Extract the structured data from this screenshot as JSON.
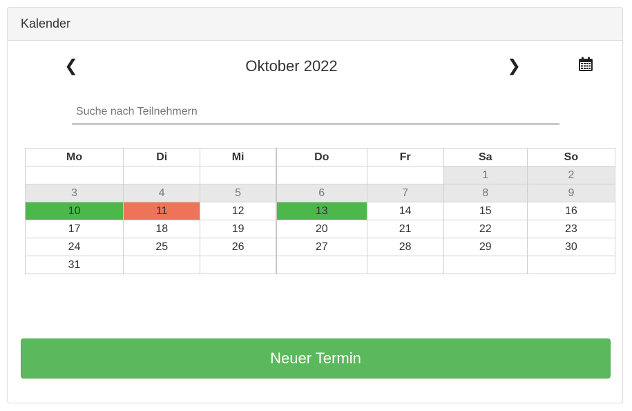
{
  "panel": {
    "title": "Kalender"
  },
  "nav": {
    "prev_icon": "❮",
    "next_icon": "❯",
    "month_title": "Oktober 2022",
    "calendar_icon": "calendar-icon"
  },
  "search": {
    "placeholder": "Suche nach Teilnehmern",
    "value": ""
  },
  "calendar": {
    "weekdays": [
      "Mo",
      "Di",
      "Mi",
      "Do",
      "Fr",
      "Sa",
      "So"
    ],
    "weeks": [
      [
        {
          "d": ""
        },
        {
          "d": ""
        },
        {
          "d": ""
        },
        {
          "d": ""
        },
        {
          "d": ""
        },
        {
          "d": "1",
          "s": "muted"
        },
        {
          "d": "2",
          "s": "muted"
        }
      ],
      [
        {
          "d": "3",
          "s": "muted"
        },
        {
          "d": "4",
          "s": "muted"
        },
        {
          "d": "5",
          "s": "muted"
        },
        {
          "d": "6",
          "s": "muted"
        },
        {
          "d": "7",
          "s": "muted"
        },
        {
          "d": "8",
          "s": "muted"
        },
        {
          "d": "9",
          "s": "muted"
        }
      ],
      [
        {
          "d": "10",
          "s": "green"
        },
        {
          "d": "11",
          "s": "red"
        },
        {
          "d": "12"
        },
        {
          "d": "13",
          "s": "green"
        },
        {
          "d": "14"
        },
        {
          "d": "15"
        },
        {
          "d": "16"
        }
      ],
      [
        {
          "d": "17"
        },
        {
          "d": "18"
        },
        {
          "d": "19"
        },
        {
          "d": "20"
        },
        {
          "d": "21"
        },
        {
          "d": "22"
        },
        {
          "d": "23"
        }
      ],
      [
        {
          "d": "24"
        },
        {
          "d": "25"
        },
        {
          "d": "26"
        },
        {
          "d": "27"
        },
        {
          "d": "28"
        },
        {
          "d": "29"
        },
        {
          "d": "30"
        }
      ],
      [
        {
          "d": "31"
        },
        {
          "d": ""
        },
        {
          "d": ""
        },
        {
          "d": ""
        },
        {
          "d": ""
        },
        {
          "d": ""
        },
        {
          "d": ""
        }
      ]
    ],
    "colors": {
      "booked": "#4cb84c",
      "conflict": "#ee7358",
      "past": "#e8e8e8"
    }
  },
  "actions": {
    "new_label": "Neuer Termin"
  }
}
